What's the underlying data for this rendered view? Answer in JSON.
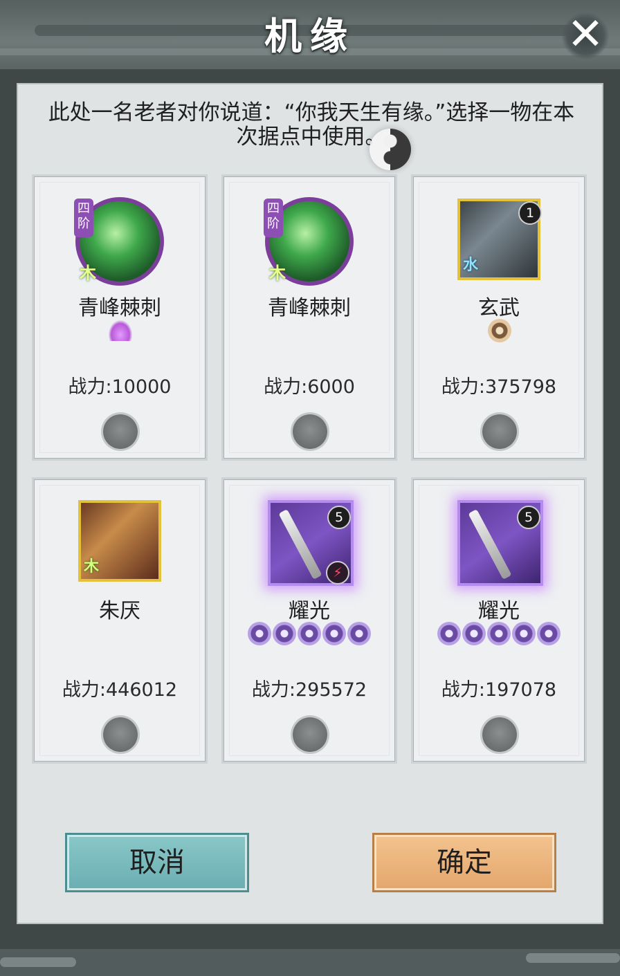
{
  "dialog": {
    "title": "机缘",
    "prompt": "此处一名老者对你说道：“你我天生有缘。”选择一物在本次据点中使用。"
  },
  "cards": [
    {
      "name": "青峰棘刺",
      "power": "战力:10000",
      "tag": "四阶",
      "element": "木",
      "kind": "skill-orb"
    },
    {
      "name": "青峰棘刺",
      "power": "战力:6000",
      "tag": "四阶",
      "element": "木",
      "kind": "skill-orb"
    },
    {
      "name": "玄武",
      "power": "战力:375798",
      "badge": "1",
      "element": "水",
      "kind": "pet-portrait"
    },
    {
      "name": "朱厌",
      "power": "战力:446012",
      "element": "木",
      "kind": "pet-portrait"
    },
    {
      "name": "耀光",
      "power": "战力:295572",
      "badge": "5",
      "stars": 5,
      "kind": "weapon"
    },
    {
      "name": "耀光",
      "power": "战力:197078",
      "badge": "5",
      "stars": 5,
      "kind": "weapon"
    }
  ],
  "buttons": {
    "cancel": "取消",
    "confirm": "确定"
  },
  "colors": {
    "cancel_bg": "#7bbabe",
    "confirm_bg": "#eab47c",
    "panel_bg": "#dfe3e4",
    "star_purple": "#6a4aa3"
  }
}
